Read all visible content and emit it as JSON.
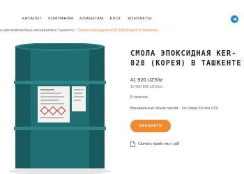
{
  "nav": {
    "items": [
      {
        "label": "Каталог"
      },
      {
        "label": "Компания"
      },
      {
        "label": "Клиентам"
      },
      {
        "label": "Блог"
      },
      {
        "label": "Контакты"
      }
    ],
    "telegram_icon": "telegram-icon"
  },
  "breadcrumb": {
    "parent": "ы для композитных материалов в Ташкенте",
    "separator": "/",
    "current": "Смола эпоксидная KER-828 (Корея) в Ташкенте"
  },
  "product": {
    "title": "Смола эпоксидная KER-828 (Корея) в Ташкенте",
    "price": "41 920 UZS/кг",
    "price_secondary": "10 060 800 UZS/шт.",
    "availability": "В наличии",
    "min_order_label": "Минимальный объем партии:",
    "min_order_value": "На сумму 60 млн UZS",
    "order_button": "Заказать",
    "pricelist_link": "Скачать прайс-лист: pdf",
    "barrel_color": "#1f6f73",
    "accent_color": "#f08a2c"
  }
}
